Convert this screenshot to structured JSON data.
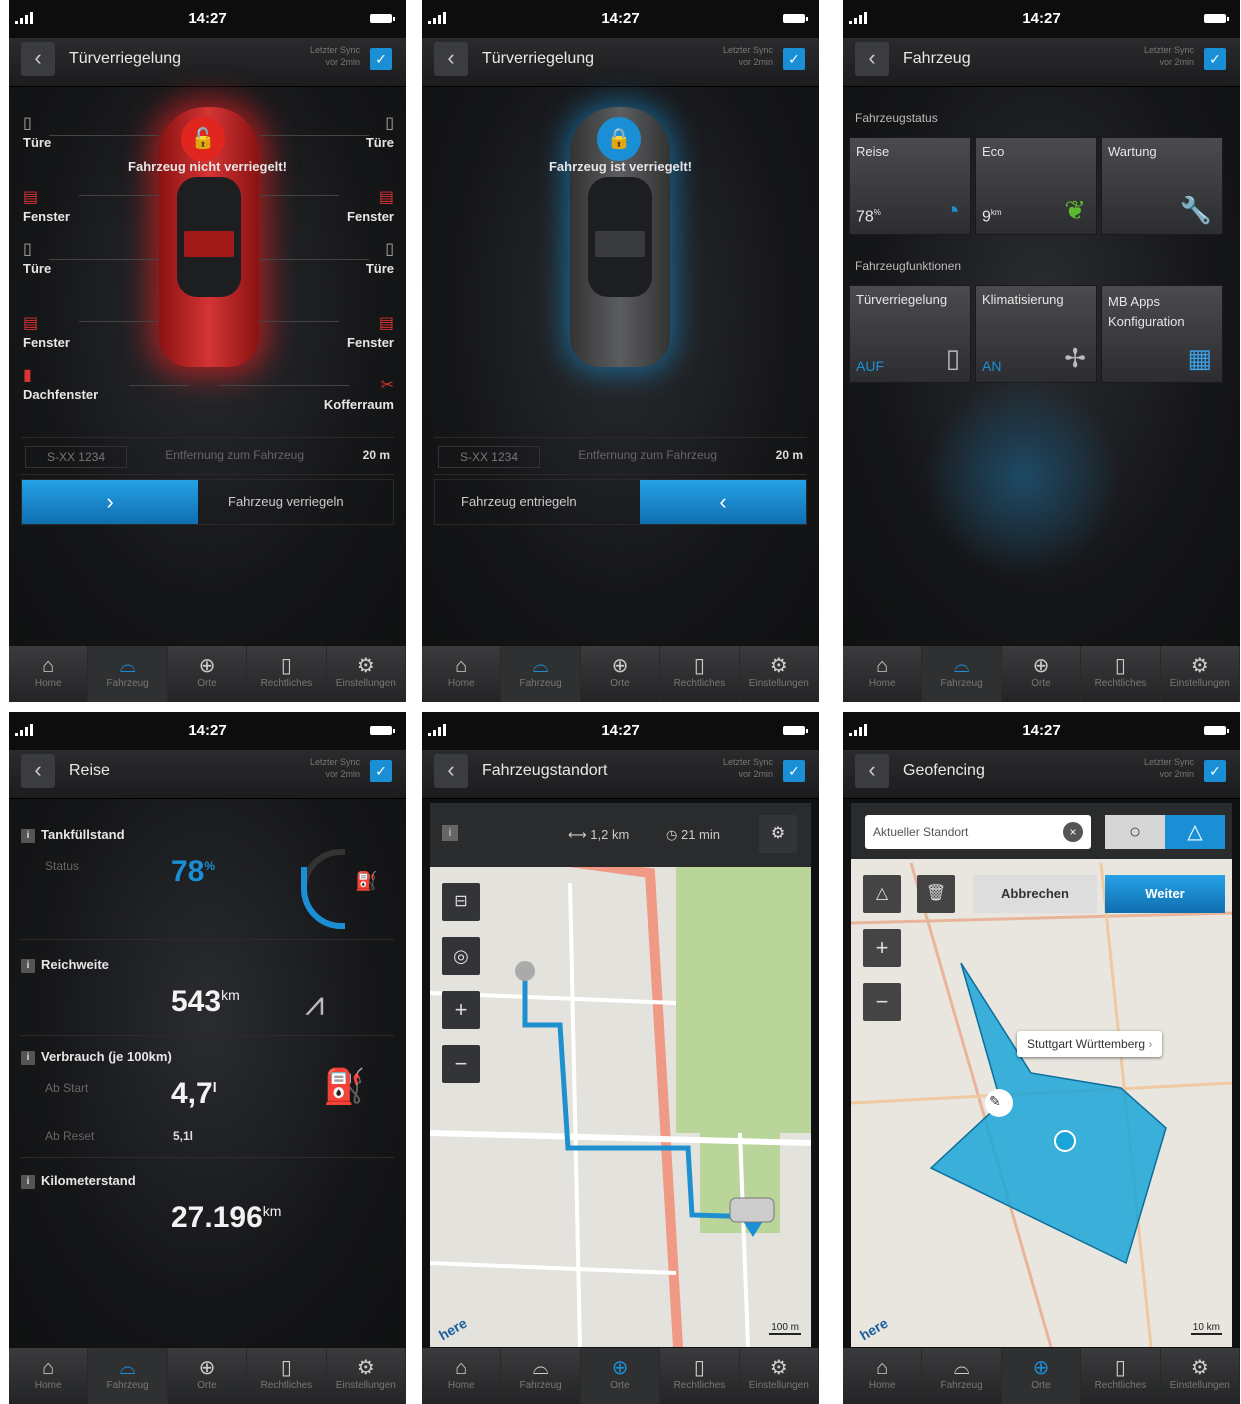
{
  "status": {
    "time": "14:27"
  },
  "sync": {
    "line1": "Letzter Sync",
    "line2": "vor 2min"
  },
  "tabs": [
    {
      "label": "Home",
      "icon": "home-icon"
    },
    {
      "label": "Fahrzeug",
      "icon": "car-icon"
    },
    {
      "label": "Orte",
      "icon": "crosshair-icon"
    },
    {
      "label": "Rechtliches",
      "icon": "document-icon"
    },
    {
      "label": "Einstellungen",
      "icon": "gear-icon"
    }
  ],
  "screen1": {
    "title": "Türverriegelung",
    "message": "Fahrzeug nicht verriegelt!",
    "sensors": {
      "door_fl": "Türe",
      "door_fr": "Türe",
      "window_fl": "Fenster",
      "window_fr": "Fenster",
      "door_rl": "Türe",
      "door_rr": "Türe",
      "window_rl": "Fenster",
      "window_rr": "Fenster",
      "sunroof": "Dachfenster",
      "trunk": "Kofferraum"
    },
    "plate": "S-XX 1234",
    "distance_label": "Entfernung zum Fahrzeug",
    "distance_value": "20 m",
    "action": "Fahrzeug verriegeln",
    "accent": "#e0261f"
  },
  "screen2": {
    "title": "Türverriegelung",
    "message": "Fahrzeug ist verriegelt!",
    "plate": "S-XX 1234",
    "distance_label": "Entfernung zum Fahrzeug",
    "distance_value": "20 m",
    "action": "Fahrzeug entriegeln",
    "accent": "#1a8fd6"
  },
  "screen3": {
    "title": "Fahrzeug",
    "status_section": "Fahrzeugstatus",
    "status_tiles": [
      {
        "label": "Reise",
        "value": "78",
        "unit": "%"
      },
      {
        "label": "Eco",
        "value": "9",
        "unit": "km"
      },
      {
        "label": "Wartung"
      }
    ],
    "functions_section": "Fahrzeugfunktionen",
    "function_tiles": [
      {
        "label": "Türverriegelung",
        "value": "AUF"
      },
      {
        "label": "Klimatisierung",
        "value": "AN"
      },
      {
        "label": "MB Apps Konfiguration"
      }
    ]
  },
  "screen4": {
    "title": "Reise",
    "fuel": {
      "label": "Tankfüllstand",
      "sub": "Status",
      "value": "78",
      "unit": "%",
      "level": 78
    },
    "range": {
      "label": "Reichweite",
      "value": "543",
      "unit": "km"
    },
    "consumption": {
      "label": "Verbrauch (je 100km)",
      "start_label": "Ab Start",
      "start_value": "4,7",
      "start_unit": "l",
      "reset_label": "Ab Reset",
      "reset_value": "5,1l"
    },
    "odometer": {
      "label": "Kilometerstand",
      "value": "27.196",
      "unit": "km"
    }
  },
  "screen5": {
    "title": "Fahrzeugstandort",
    "distance": "1,2 km",
    "duration": "21 min",
    "scale": "100 m",
    "brand": "here"
  },
  "screen6": {
    "title": "Geofencing",
    "search_value": "Aktueller Standort",
    "cancel": "Abbrechen",
    "next": "Weiter",
    "callout": "Stuttgart Württemberg",
    "scale": "10 km",
    "brand": "here"
  }
}
